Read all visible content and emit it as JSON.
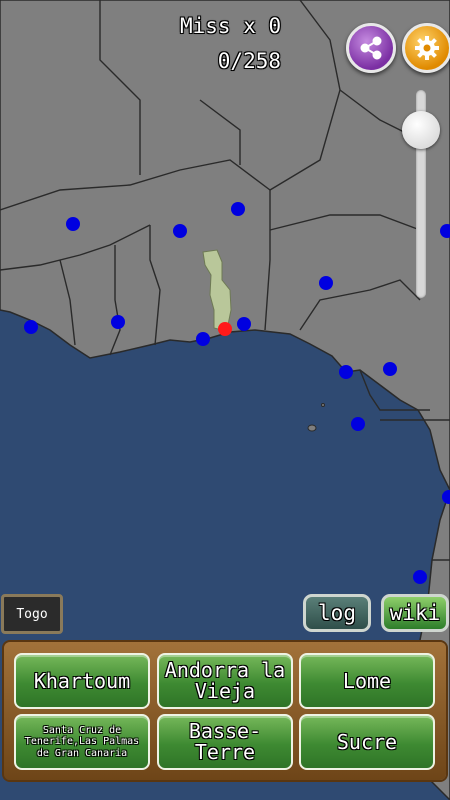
{
  "hud": {
    "miss": "Miss x 0",
    "score": "0/258"
  },
  "colors": {
    "ocean": "#2f4a72",
    "land": "#7f7f7f",
    "border": "#2a2a2a",
    "city_marker": "#0000e0",
    "target_marker": "#ff1a1a",
    "highlight_country": "#b9c79a"
  },
  "icons": {
    "share": "share-icon",
    "settings": "gear-icon"
  },
  "country_label": "Togo",
  "buttons": {
    "log": "log",
    "wiki": "wiki"
  },
  "answers": [
    {
      "label": "Khartoum"
    },
    {
      "label": "Andorra la Vieja"
    },
    {
      "label": "Lome"
    },
    {
      "label": "Santa Cruz de Tenerife,Las Palmas de Gran Canaria"
    },
    {
      "label": "Basse-Terre"
    },
    {
      "label": "Sucre"
    }
  ]
}
